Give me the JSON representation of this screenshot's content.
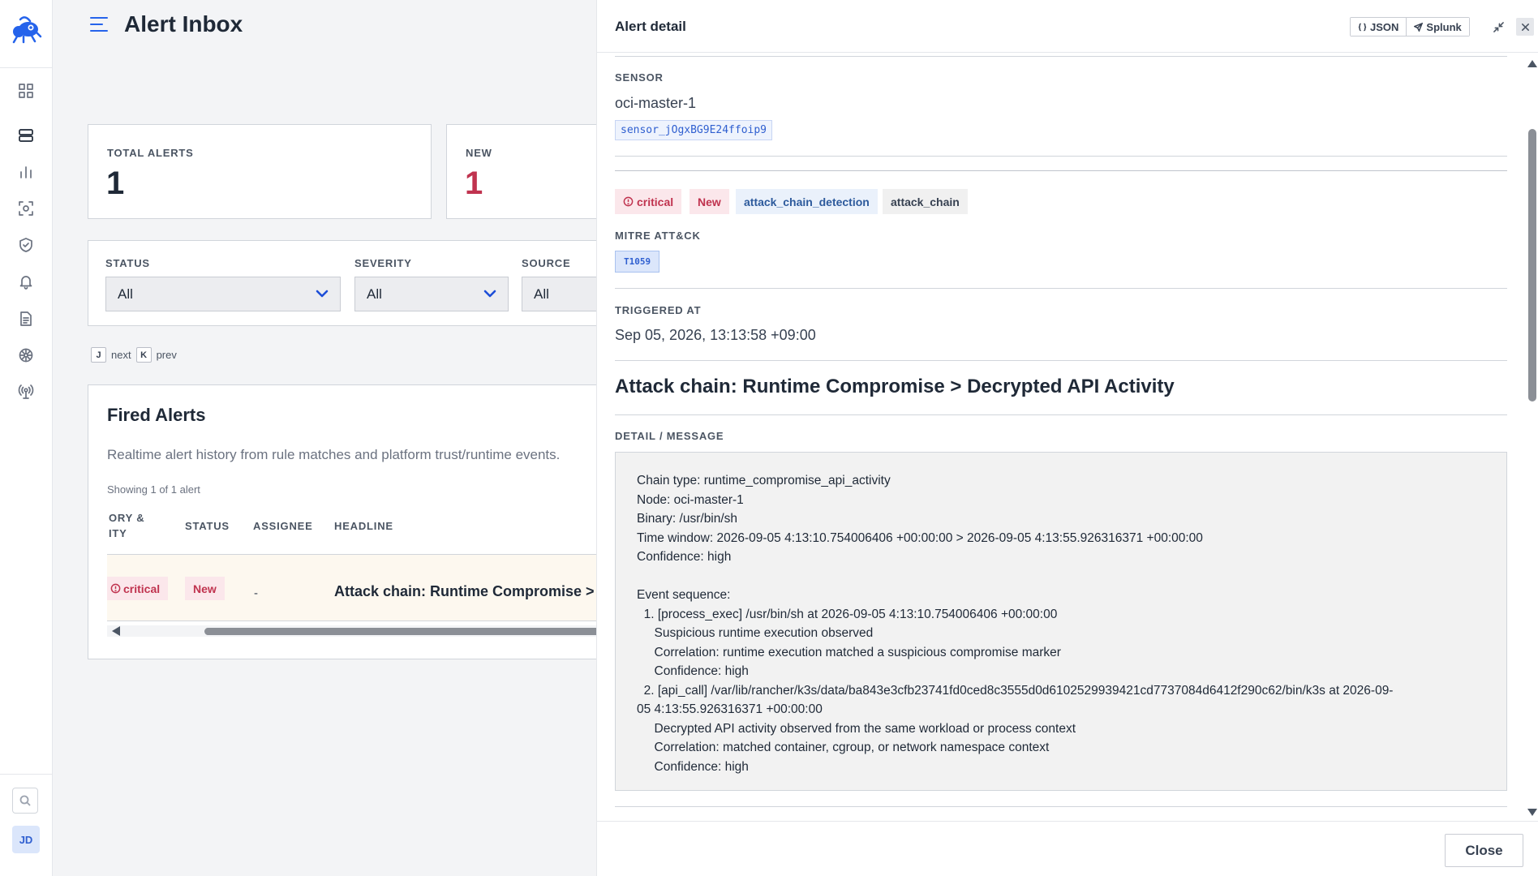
{
  "sidebar": {
    "nav_icons": [
      "dashboard-icon",
      "server-icon",
      "chart-icon",
      "scan-icon",
      "shield-icon",
      "bell-icon",
      "document-icon",
      "network-icon",
      "antenna-icon"
    ],
    "avatar_initials": "JD"
  },
  "page": {
    "title": "Alert Inbox"
  },
  "stats": [
    {
      "label": "TOTAL ALERTS",
      "value": "1"
    },
    {
      "label": "NEW",
      "value": "1"
    }
  ],
  "filters": [
    {
      "label": "STATUS",
      "value": "All"
    },
    {
      "label": "SEVERITY",
      "value": "All"
    },
    {
      "label": "SOURCE",
      "value": "All"
    }
  ],
  "shortcuts": {
    "next_key": "J",
    "next_label": "next",
    "prev_key": "K",
    "prev_label": "prev"
  },
  "alerts_panel": {
    "title": "Fired Alerts",
    "subtitle": "Realtime alert history from rule matches and platform trust/runtime events.",
    "count": "Showing 1 of 1 alert",
    "columns": [
      "ORY &\nITY",
      "STATUS",
      "ASSIGNEE",
      "HEADLINE"
    ],
    "rows": [
      {
        "severity": "critical",
        "status": "New",
        "assignee": "-",
        "headline": "Attack chain: Runtime Compromise > D"
      }
    ]
  },
  "drawer": {
    "title": "Alert detail",
    "json_label": "JSON",
    "splunk_label": "Splunk",
    "sensor_label": "SENSOR",
    "sensor_name": "oci-master-1",
    "sensor_id": "sensor_jOgxBG9E24ffoip9",
    "tags": [
      "critical",
      "New",
      "attack_chain_detection",
      "attack_chain"
    ],
    "mitre_label": "MITRE ATT&CK",
    "mitre_technique": "T1059",
    "triggered_label": "TRIGGERED AT",
    "triggered_at": "Sep 05, 2026, 13:13:58 +09:00",
    "headline": "Attack chain: Runtime Compromise > Decrypted API Activity",
    "message_label": "DETAIL / MESSAGE",
    "message_lines": [
      "Chain type: runtime_compromise_api_activity",
      "Node: oci-master-1",
      "Binary: /usr/bin/sh",
      "Time window: 2026-09-05 4:13:10.754006406 +00:00:00 > 2026-09-05 4:13:55.926316371 +00:00:00",
      "Confidence: high",
      "",
      "Event sequence:",
      "  1. [process_exec] /usr/bin/sh at 2026-09-05 4:13:10.754006406 +00:00:00",
      "     Suspicious runtime execution observed",
      "     Correlation: runtime execution matched a suspicious compromise marker",
      "     Confidence: high",
      "  2. [api_call] /var/lib/rancher/k3s/data/ba843e3cfb23741fd0ced8c3555d0d6102529939421cd7737084d6412f290c62/bin/k3s at 2026-09-",
      "05 4:13:55.926316371 +00:00:00",
      "     Decrypted API activity observed from the same workload or process context",
      "     Correlation: matched container, cgroup, or network namespace context",
      "     Confidence: high"
    ],
    "close_label": "Close"
  },
  "colors": {
    "accent": "#2563eb",
    "critical": "#c0334f",
    "critical_bg": "#fbe7eb"
  }
}
